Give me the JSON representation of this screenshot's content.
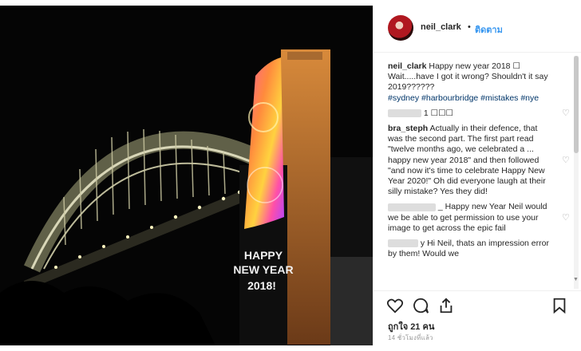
{
  "post": {
    "username": "neil_clark",
    "follow_label": "ติดตาม",
    "dot": "•",
    "photo_text": [
      "HAPPY",
      "NEW YEAR",
      "2018!"
    ],
    "likes": "ถูกใจ 21 คน",
    "time": "14 ชั่วโมงที่แล้ว"
  },
  "comments": [
    {
      "user": "neil_clark",
      "parts": [
        "Happy new year 2018 ☐",
        "Wait.....have I got it wrong? Shouldn't it say 2019??????"
      ],
      "tags": "#sydney #harbourbridge #mistakes #nye"
    },
    {
      "user": "",
      "text": "1 ☐☐☐"
    },
    {
      "user": "bra_steph",
      "text": "Actually in their defence, that was the second part. The first part read \"twelve months ago, we celebrated a ... happy new year 2018\" and then followed \"and now it's time to celebrate Happy New Year 2020!\" Oh did everyone laugh at their silly mistake? Yes they did!"
    },
    {
      "user": "",
      "text": "_ Happy new Year Neil would we be able to get permission to use your image to get across the epic fail"
    },
    {
      "user": "",
      "text": "y Hi Neil, thats an impression error by them! Would we"
    }
  ],
  "icons": {
    "heart": "heart-icon",
    "comment": "comment-icon",
    "share": "share-icon",
    "save": "bookmark-icon"
  }
}
